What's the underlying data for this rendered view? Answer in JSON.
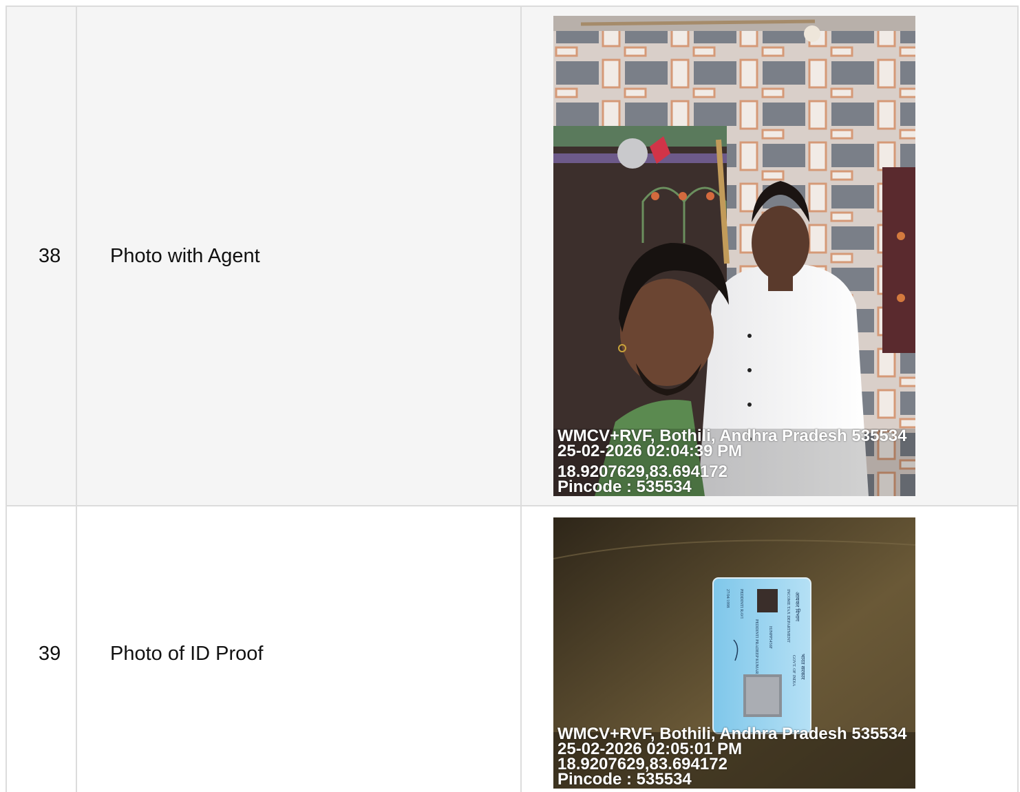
{
  "rows": [
    {
      "number": "38",
      "label": "Photo with Agent",
      "photo": {
        "geo_address": "WMCV+RVF, Bothili, Andhra Pradesh 535534",
        "timestamp": "25-02-2026 02:04:39 PM",
        "coordinates": "18.9207629,83.694172",
        "pincode": "Pincode : 535534"
      }
    },
    {
      "number": "39",
      "label": "Photo of ID Proof",
      "photo": {
        "geo_address": "WMCV+RVF, Bothili, Andhra Pradesh 535534",
        "timestamp": "25-02-2026 02:05:01 PM",
        "coordinates": "18.9207629,83.694172",
        "pincode": "Pincode : 535534",
        "card_text": {
          "hindi_dept": "आयकर विभाग",
          "dept": "INCOME TAX DEPARTMENT",
          "hindi_govt": "भारत सरकार",
          "govt": "GOVT. OF INDIA",
          "name": "PEDDINTI PRADEEP KUMAR",
          "father": "PEDDINTI RAVI",
          "dob": "27/04/1998",
          "pan": "HJNPP5456F"
        }
      }
    }
  ]
}
